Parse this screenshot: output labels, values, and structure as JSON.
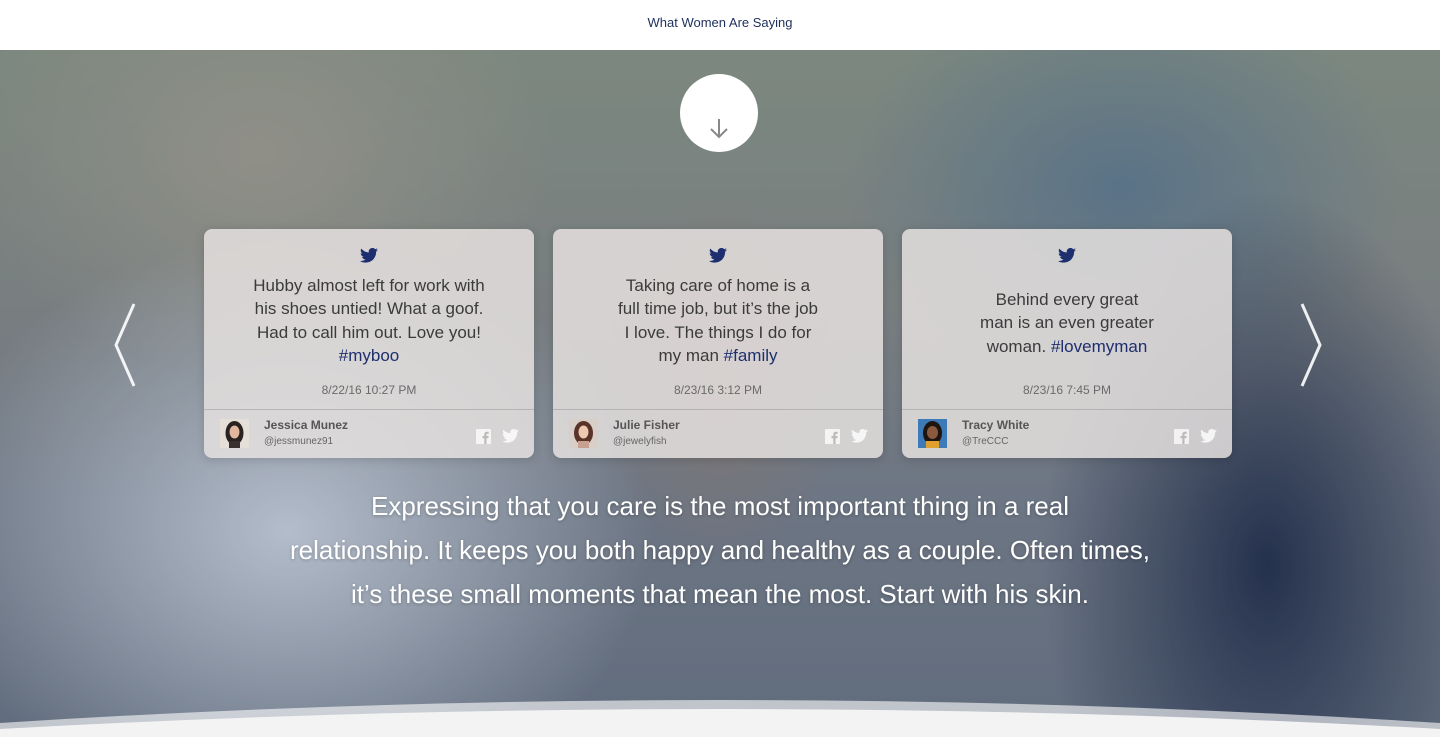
{
  "header": {
    "title": "What Women Are Saying"
  },
  "icons": {
    "scroll": "arrow-down-icon",
    "prev": "chevron-left-icon",
    "next": "chevron-right-icon",
    "bird": "twitter-icon",
    "facebook": "facebook-icon",
    "twitter": "twitter-icon"
  },
  "colors": {
    "brand": "#1d2f6e",
    "hashtag": "#1d2f6e"
  },
  "testimonials": [
    {
      "tweet_lines": [
        "Hubby almost left for work with",
        "his shoes untied! What a goof.",
        "Had to call him out. Love you!"
      ],
      "hashtag": "#myboo",
      "timestamp": "8/22/16 10:27 PM",
      "name": "Jessica Munez",
      "handle": "@jessmunez91"
    },
    {
      "tweet_lines": [
        "Taking care of home is a",
        "full time job, but it’s the job",
        "I love. The things I do for",
        "my man "
      ],
      "hashtag": "#family",
      "timestamp": "8/23/16  3:12 PM",
      "name": "Julie Fisher",
      "handle": "@jewelyfish"
    },
    {
      "tweet_lines": [
        "Behind every great",
        "man is an even greater",
        "woman. "
      ],
      "hashtag": "#lovemyman",
      "timestamp": "8/23/16 7:45 PM",
      "name": "Tracy White",
      "handle": "@TreCCC"
    }
  ],
  "message": {
    "lines": [
      "Expressing that you care is the most important thing in a real",
      "relationship. It keeps you both happy and healthy as a couple. Often times,",
      "it’s these small moments that mean the most. Start with his skin."
    ]
  }
}
